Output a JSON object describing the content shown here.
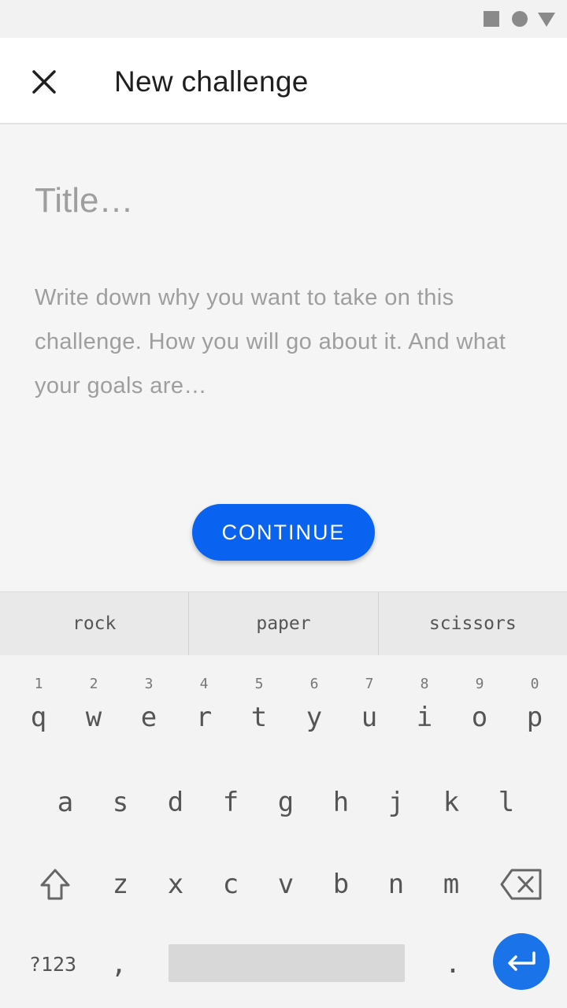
{
  "app_bar": {
    "title": "New challenge",
    "close_icon": "close-icon"
  },
  "form": {
    "title_placeholder": "Title…",
    "description_placeholder": "Write down why you want to take on this challenge. How you will go about it. And what your goals are…",
    "continue_label": "CONTINUE"
  },
  "keyboard": {
    "suggestions": [
      "rock",
      "paper",
      "scissors"
    ],
    "row1": [
      "q",
      "w",
      "e",
      "r",
      "t",
      "y",
      "u",
      "i",
      "o",
      "p"
    ],
    "row1_numbers": [
      "1",
      "2",
      "3",
      "4",
      "5",
      "6",
      "7",
      "8",
      "9",
      "0"
    ],
    "row2": [
      "a",
      "s",
      "d",
      "f",
      "g",
      "h",
      "j",
      "k",
      "l"
    ],
    "row3": [
      "z",
      "x",
      "c",
      "v",
      "b",
      "n",
      "m"
    ],
    "symbols_label": "?123",
    "comma": ",",
    "period": ".",
    "icons": {
      "shift": "shift-icon",
      "backspace": "backspace-icon",
      "enter": "enter-icon"
    }
  },
  "colors": {
    "accent": "#0a63f0",
    "enter": "#1a73e8",
    "background": "#f5f5f5"
  }
}
